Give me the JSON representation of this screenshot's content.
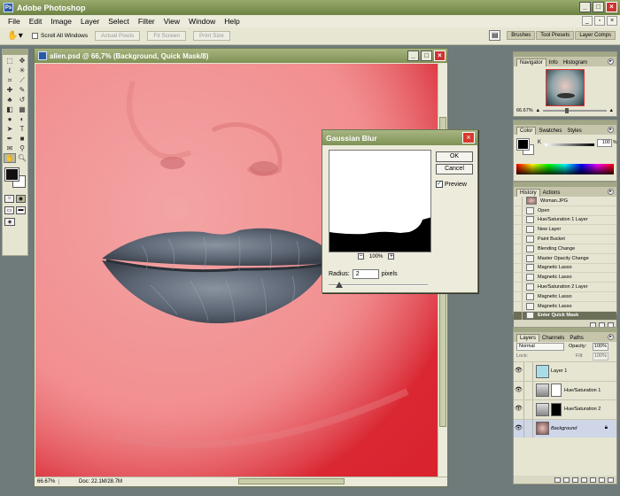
{
  "app": {
    "title": "Adobe Photoshop",
    "colors": {
      "titlebar": "#7f9155",
      "mask_overlay": "#f28e90",
      "dialog_close": "#d63a2e"
    }
  },
  "menu": [
    "File",
    "Edit",
    "Image",
    "Layer",
    "Select",
    "Filter",
    "View",
    "Window",
    "Help"
  ],
  "options_bar": {
    "tool_icon": "hand-icon",
    "scroll_all_windows": "Scroll All Windows",
    "actual_pixels": "Actual Pixels",
    "fit_screen": "Fit Screen",
    "print_size": "Print Size",
    "palette_well_tabs": [
      "Brushes",
      "Tool Presets",
      "Layer Comps"
    ]
  },
  "document": {
    "title": "alien.psd @ 66,7% (Background, Quick Mask/8)",
    "zoom": "66.67%",
    "doc_size": "Doc: 22.1M/28.7M"
  },
  "gaussian_blur": {
    "title": "Gaussian Blur",
    "ok": "OK",
    "cancel": "Cancel",
    "preview_label": "Preview",
    "preview_checked": true,
    "zoom": "100%",
    "radius_label": "Radius:",
    "radius_value": "2",
    "radius_unit": "pixels"
  },
  "navigator": {
    "tabs": [
      "Navigator",
      "Info",
      "Histogram"
    ],
    "zoom": "66.67%"
  },
  "color": {
    "tabs": [
      "Color",
      "Swatches",
      "Styles"
    ],
    "channel": "K",
    "value": "100",
    "unit": "%"
  },
  "history": {
    "tabs": [
      "History",
      "Actions"
    ],
    "snapshot": "Woman.JPG",
    "items": [
      "Open",
      "Hue/Saturation 1 Layer",
      "New Layer",
      "Paint Bucket",
      "Blending Change",
      "Master Opacity Change",
      "Magnetic Lasso",
      "Magnetic Lasso",
      "Hue/Saturation 2 Layer",
      "Magnetic Lasso",
      "Magnetic Lasso",
      "Enter Quick Mask"
    ]
  },
  "layers": {
    "tabs": [
      "Layers",
      "Channels",
      "Paths"
    ],
    "blend_mode": "Normal",
    "opacity_label": "Opacity:",
    "opacity": "100%",
    "lock_label": "Lock:",
    "fill_label": "Fill:",
    "fill": "100%",
    "items": [
      "Layer 1",
      "Hue/Saturation 1",
      "Hue/Saturation 2",
      "Background"
    ]
  }
}
